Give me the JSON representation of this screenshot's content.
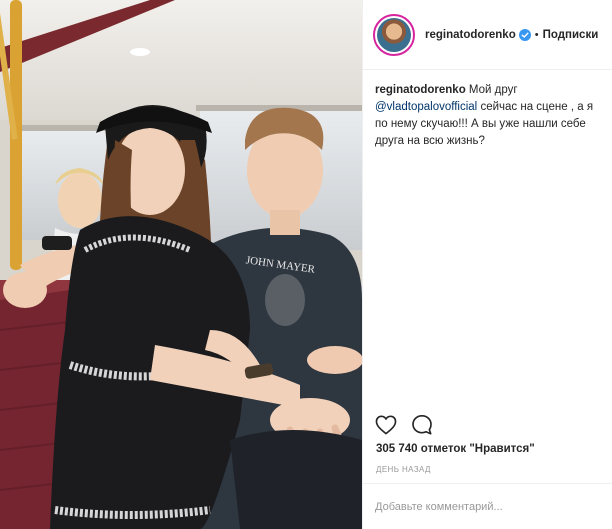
{
  "post": {
    "username": "reginatodorenko",
    "follow_label": "Подписки",
    "caption_username": "reginatodorenko",
    "caption_text_1": " Мой друг ",
    "caption_mention": "@vladtopalovofficial",
    "caption_text_2": " сейчас на сцене , а я по нему скучаю!!! А вы уже нашли себе друга на всю жизнь?",
    "likes": "305 740 отметок \"Нравится\"",
    "time": "день назад",
    "comment_placeholder": "Добавьте комментарий...",
    "shirt_print": "JOHN MAYER"
  },
  "colors": {
    "verified": "#3897f0",
    "mention": "#003569",
    "muted": "#999999"
  },
  "icons": [
    "verified-badge-icon",
    "heart-icon",
    "comment-icon"
  ]
}
